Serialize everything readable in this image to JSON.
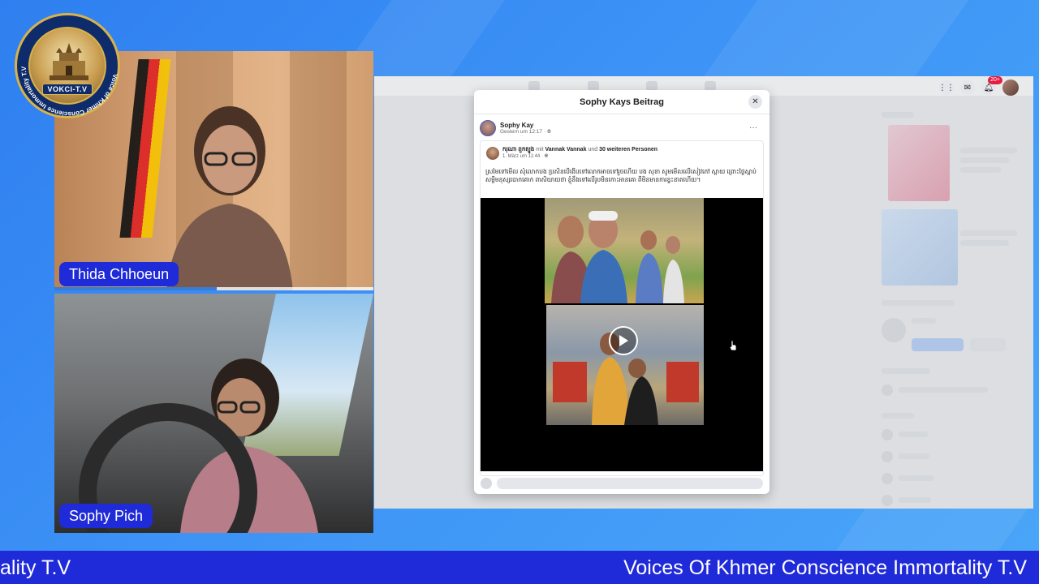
{
  "ticker": {
    "left_fragment": "ality T.V",
    "right_text": "Voices Of Khmer Conscience Immortality T.V"
  },
  "logo": {
    "badge": "VOKCI-T.V",
    "ring_text": "Voice of Khmer Conscience Immortality T.V"
  },
  "participants": [
    {
      "name": "Thida Chhoeun",
      "progress": 0.51
    },
    {
      "name": "Sophy Pich"
    }
  ],
  "modal": {
    "title": "Sophy Kays Beitrag",
    "close": "✕",
    "post": {
      "author": "Sophy Kay",
      "time": "Gestern um 12:17 · ",
      "more": "···",
      "shared": {
        "author": "ករុណា ពួកត្បូង",
        "with": "mit",
        "tagged": "Vannak Vannak",
        "and": "und",
        "others": "30 weiteren Personen",
        "time": "1. März um 11:44 · ",
        "text": "ស្រមៃទៅមើល សុំលោកបង ប្រសិនបើងើបទៅលោកអាចទៅរួចហើយ បង សុខា សូមមើលលើសៀវភៅ ស្តាយ ព្រោះថ្ងៃស្អាប់សម្ដីមនុស្សបោកគោក ពាសិយាយថា ខ្ញុំនឹងទៅលើរូបមិនកោះអានគោ ពីមិនមានការខ្វះខាតហើយ។"
      }
    }
  },
  "colors": {
    "ticker_bg": "#1f2ad8",
    "name_tag_bg": "#1f2ad8",
    "page_bg": "#3d93f6"
  },
  "icons": [
    "grid-icon",
    "messenger-icon",
    "bell-icon",
    "close-icon",
    "play-icon",
    "more-icon",
    "globe-icon"
  ],
  "notifications_badge": "20+"
}
